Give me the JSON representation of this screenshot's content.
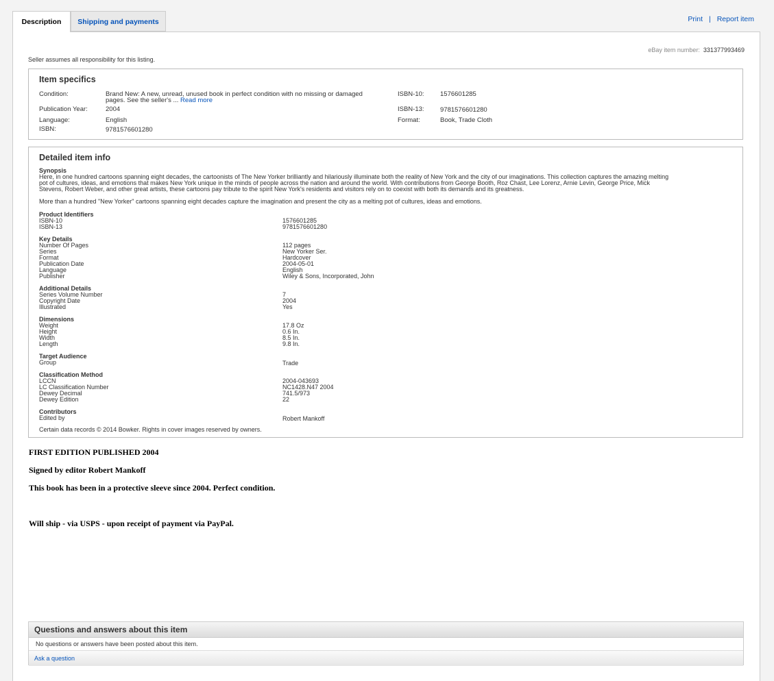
{
  "tabs": [
    {
      "label": "Description",
      "active": true
    },
    {
      "label": "Shipping and payments",
      "active": false
    }
  ],
  "top_links": {
    "print": "Print",
    "separator": "|",
    "report": "Report item"
  },
  "item_number": {
    "label": "eBay item number:",
    "value": "331377993469"
  },
  "responsibility": "Seller assumes all responsibility for this listing.",
  "item_specifics": {
    "title": "Item specifics",
    "condition_label": "Condition:",
    "condition_value": "Brand New: A new, unread, unused book in perfect condition with no missing or damaged",
    "condition_value2": "pages. See the seller's ...",
    "read_more": "Read more",
    "pubyear_label": "Publication Year:",
    "pubyear_value": "2004",
    "language_label": "Language:",
    "language_value": "English",
    "isbn_label": "ISBN:",
    "isbn_value": "9781576601280",
    "isbn10_label": "ISBN-10:",
    "isbn10_value": "1576601285",
    "isbn13_label": "ISBN-13:",
    "isbn13_value": "9781576601280",
    "format_label": "Format:",
    "format_value": "Book, Trade Cloth"
  },
  "detailed": {
    "title": "Detailed item info",
    "synopsis_heading": "Synopsis",
    "synopsis_lines": [
      "Here, in one hundred cartoons spanning eight decades, the cartoonists of The New Yorker brilliantly and hilariously illuminate both the reality of New York and the city of our imaginations. This collection captures the amazing melting",
      "pot of cultures, ideas, and emotions that makes New York unique in the minds of people across the nation and around the world. With contributions from George Booth, Roz Chast, Lee Lorenz, Arnie Levin, George Price, Mick",
      "Stevens, Robert Weber, and other great artists, these cartoons pay tribute to the spirit New York's residents and visitors rely on to coexist with both its demands and its greatness."
    ],
    "summary": "More than a hundred \"New Yorker\" cartoons spanning eight decades capture the imagination and present the city as a melting pot of cultures, ideas and emotions.",
    "sections": [
      {
        "heading": "Product Identifiers",
        "rows": [
          [
            "ISBN-10",
            "1576601285"
          ],
          [
            "ISBN-13",
            "9781576601280"
          ]
        ]
      },
      {
        "heading": "Key Details",
        "rows": [
          [
            "Number Of Pages",
            "112 pages"
          ],
          [
            "Series",
            "New Yorker Ser."
          ],
          [
            "Format",
            "Hardcover"
          ],
          [
            "Publication Date",
            "2004-05-01"
          ],
          [
            "Language",
            "English"
          ],
          [
            "Publisher",
            "Wiley & Sons, Incorporated, John"
          ]
        ]
      },
      {
        "heading": "Additional Details",
        "rows": [
          [
            "Series Volume Number",
            "7"
          ],
          [
            "Copyright Date",
            "2004"
          ],
          [
            "Illustrated",
            "Yes"
          ]
        ]
      },
      {
        "heading": "Dimensions",
        "rows": [
          [
            "Weight",
            "17.8 Oz"
          ],
          [
            "Height",
            "0.6 In."
          ],
          [
            "Width",
            "8.5 In."
          ],
          [
            "Length",
            "9.8 In."
          ]
        ]
      },
      {
        "heading": "Target Audience",
        "rows": [
          [
            "Group",
            "Trade"
          ]
        ]
      },
      {
        "heading": "Classification Method",
        "rows": [
          [
            "LCCN",
            "2004-043693"
          ],
          [
            "LC Classification Number",
            "NC1428.N47 2004"
          ],
          [
            "Dewey Decimal",
            "741.5/973"
          ],
          [
            "Dewey Edition",
            "22"
          ]
        ]
      },
      {
        "heading": "Contributors",
        "rows": [
          [
            "Edited by",
            "Robert Mankoff"
          ]
        ]
      }
    ],
    "footer": "Certain data records © 2014 Bowker. Rights in cover images reserved by owners."
  },
  "seller_notes": [
    "FIRST EDITION PUBLISHED 2004",
    "Signed by editor Robert Mankoff",
    "This book has been in a protective sleeve since 2004. Perfect condition.",
    "Will ship - via USPS - upon receipt of  payment via PayPal."
  ],
  "qa": {
    "title": "Questions and answers about this item",
    "empty": "No questions or answers have been posted about this item.",
    "ask": "Ask a question"
  }
}
